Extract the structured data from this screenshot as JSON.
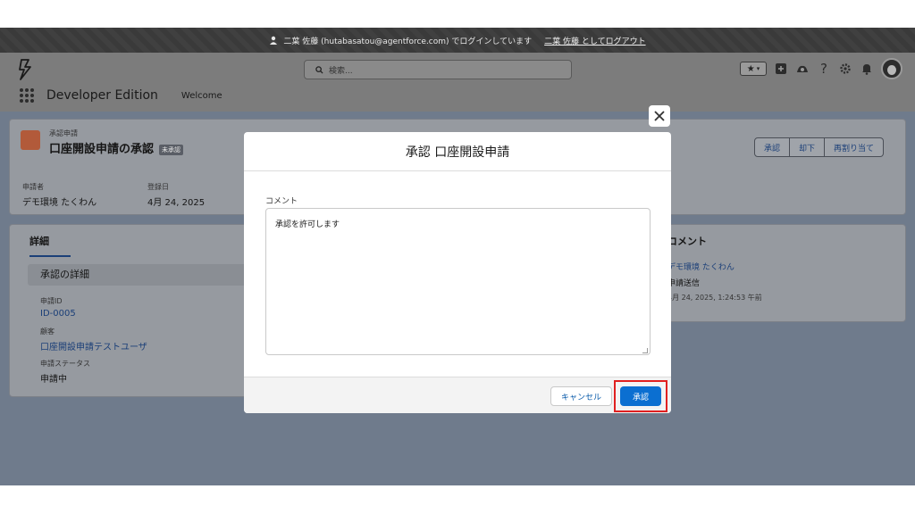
{
  "banner": {
    "login_text": "二葉 佐藤 (hutabasatou@agentforce.com) でログインしています",
    "logout_link": "二葉 佐藤 としてログアウト"
  },
  "header": {
    "search_placeholder": "検索...",
    "app_name": "Developer Edition",
    "tab_welcome": "Welcome"
  },
  "record": {
    "type_label": "承認申請",
    "title": "口座開設申請の承認",
    "badge": "未承認",
    "applicant_label": "申請者",
    "applicant_value": "デモ環境 たくわん",
    "date_label": "登録日",
    "date_value": "4月 24, 2025",
    "actions": [
      "承認",
      "却下",
      "再割り当て"
    ]
  },
  "details": {
    "tab_label": "詳細",
    "section_title": "承認の詳細",
    "fields": [
      {
        "label": "申請ID",
        "value": "ID-0005"
      },
      {
        "label": "顧客",
        "value": "口座開設申請テストユーザ"
      },
      {
        "label": "申請ステータス",
        "value": "申請中"
      }
    ]
  },
  "comments": {
    "title": "コメント",
    "author": "デモ環境 たくわん",
    "action": "申請送信",
    "timestamp": "4月 24, 2025, 1:24:53 午前"
  },
  "modal": {
    "title": "承認 口座開設申請",
    "comment_label": "コメント",
    "comment_value": "承認を許可します",
    "cancel_label": "キャンセル",
    "approve_label": "承認"
  },
  "colors": {
    "approve_button": "#0b6fd1",
    "highlight_box": "#e02020"
  }
}
